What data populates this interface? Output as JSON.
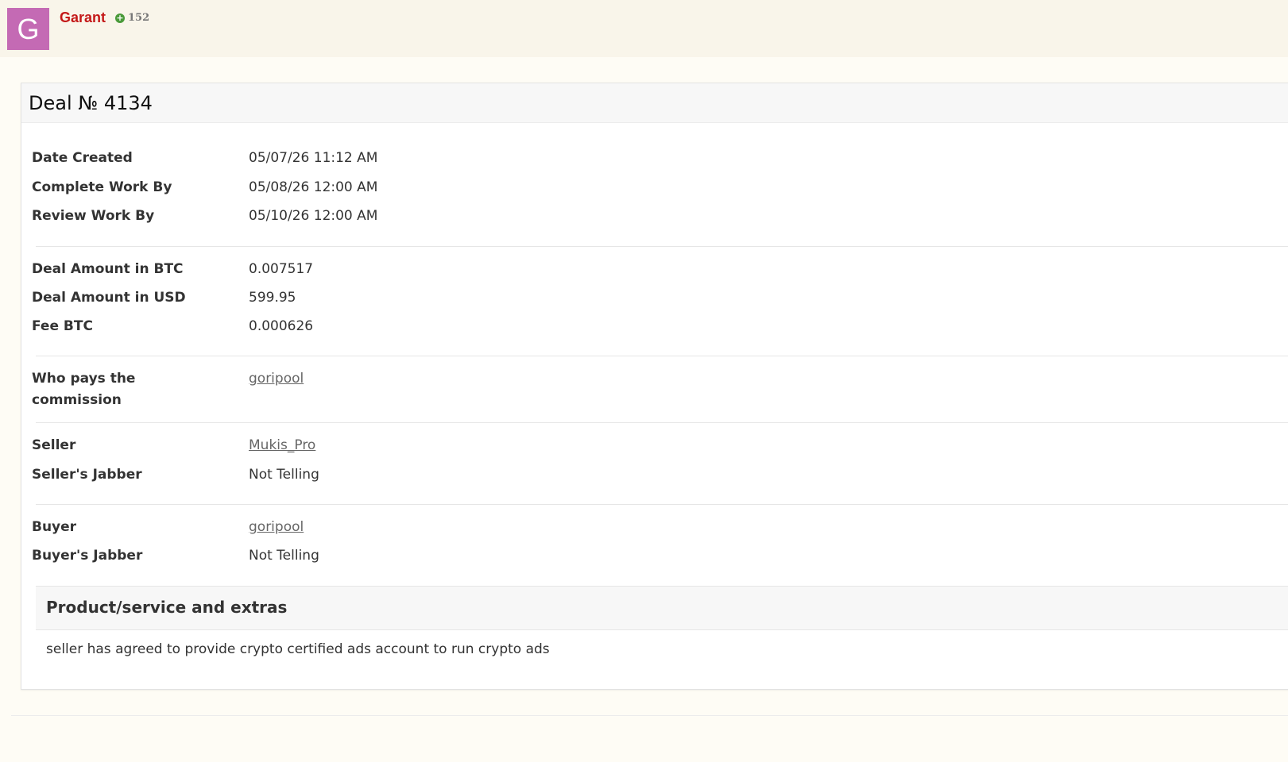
{
  "user": {
    "avatar_letter": "G",
    "name": "Garant",
    "reputation": "152",
    "reputation_icon": "plus-circle-icon",
    "avatar_color": "#c46ab4",
    "name_color": "#c41818"
  },
  "deal": {
    "title": "Deal № 4134",
    "dates": [
      {
        "label": "Date Created",
        "value": "05/07/26 11:12 AM"
      },
      {
        "label": "Complete Work By",
        "value": "05/08/26 12:00 AM"
      },
      {
        "label": "Review Work By",
        "value": "05/10/26 12:00 AM"
      }
    ],
    "amounts": [
      {
        "label": "Deal Amount in BTC",
        "value": "0.007517"
      },
      {
        "label": "Deal Amount in USD",
        "value": "599.95"
      },
      {
        "label": "Fee BTC",
        "value": "0.000626"
      }
    ],
    "commission": {
      "label": "Who pays the commission",
      "value": "goripool"
    },
    "seller": {
      "label": "Seller",
      "value": "Mukis_Pro"
    },
    "seller_jabber": {
      "label": "Seller's Jabber",
      "value": "Not Telling"
    },
    "buyer": {
      "label": "Buyer",
      "value": "goripool"
    },
    "buyer_jabber": {
      "label": "Buyer's Jabber",
      "value": "Not Telling"
    },
    "extras": {
      "title": "Product/service and extras",
      "text": "seller has agreed to provide crypto certified ads account to run crypto ads"
    }
  }
}
